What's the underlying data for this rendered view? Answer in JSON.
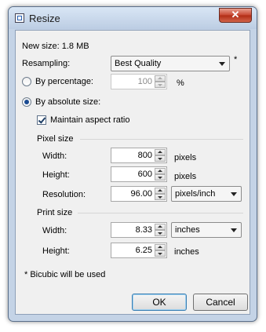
{
  "window": {
    "title": "Resize",
    "close_symbol": "✕"
  },
  "new_size": "New size: 1.8 MB",
  "resampling": {
    "label": "Resampling:",
    "value": "Best Quality",
    "note": "*"
  },
  "by_percentage": {
    "label": "By percentage:",
    "value": "100",
    "unit": "%",
    "selected": false
  },
  "by_absolute": {
    "label": "By absolute size:",
    "selected": true
  },
  "maintain_aspect": {
    "label": "Maintain aspect ratio",
    "checked": true
  },
  "pixel_size": {
    "heading": "Pixel size",
    "width": {
      "label": "Width:",
      "value": "800",
      "unit": "pixels"
    },
    "height": {
      "label": "Height:",
      "value": "600",
      "unit": "pixels"
    },
    "resolution": {
      "label": "Resolution:",
      "value": "96.00",
      "unit": "pixels/inch"
    }
  },
  "print_size": {
    "heading": "Print size",
    "width": {
      "label": "Width:",
      "value": "8.33",
      "unit": "inches"
    },
    "height": {
      "label": "Height:",
      "value": "6.25",
      "unit": "inches"
    }
  },
  "footnote": "* Bicubic will be used",
  "buttons": {
    "ok": "OK",
    "cancel": "Cancel"
  }
}
